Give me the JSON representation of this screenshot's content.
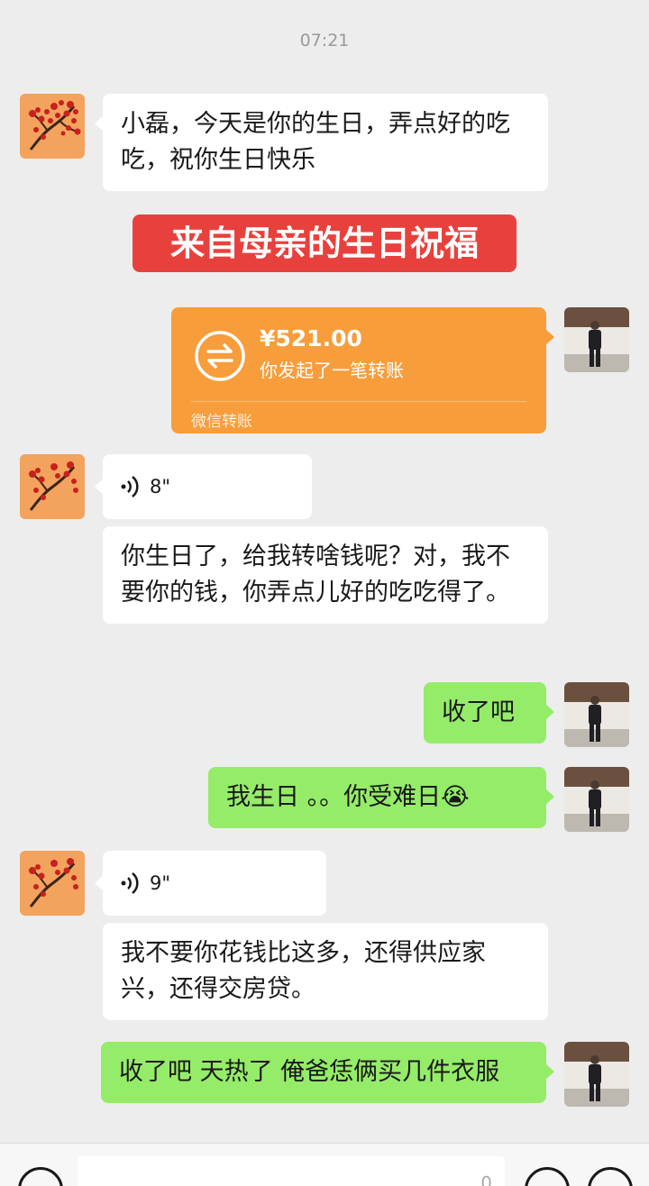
{
  "timestamp": "07:21",
  "messages": {
    "m1": "小磊，今天是你的生日，弄点好的吃吃，祝你生日快乐",
    "banner": "来自母亲的生日祝福",
    "transfer": {
      "amount": "¥521.00",
      "desc": "你发起了一笔转账",
      "source": "微信转账"
    },
    "voice1": "8\"",
    "m2": "你生日了，给我转啥钱呢？对，我不要你的钱，你弄点儿好的吃吃得了。",
    "m3": "收了吧",
    "m4": "我生日 。。你受难日😭",
    "voice2": "9\"",
    "m5": "我不要你花钱比这多，还得供应家兴，还得交房贷。",
    "m6": "收了吧   天热了    俺爸恁俩买几件衣服"
  },
  "input": {
    "counter": "0"
  },
  "colors": {
    "background": "#ededed",
    "sent_bubble": "#95ec69",
    "received_bubble": "#ffffff",
    "transfer_card": "#f79d3b",
    "banner": "#e8413d"
  },
  "icons": [
    "voice-wave-icon",
    "transfer-arrows-icon",
    "voice-toggle-icon",
    "emoji-icon",
    "plus-icon"
  ]
}
